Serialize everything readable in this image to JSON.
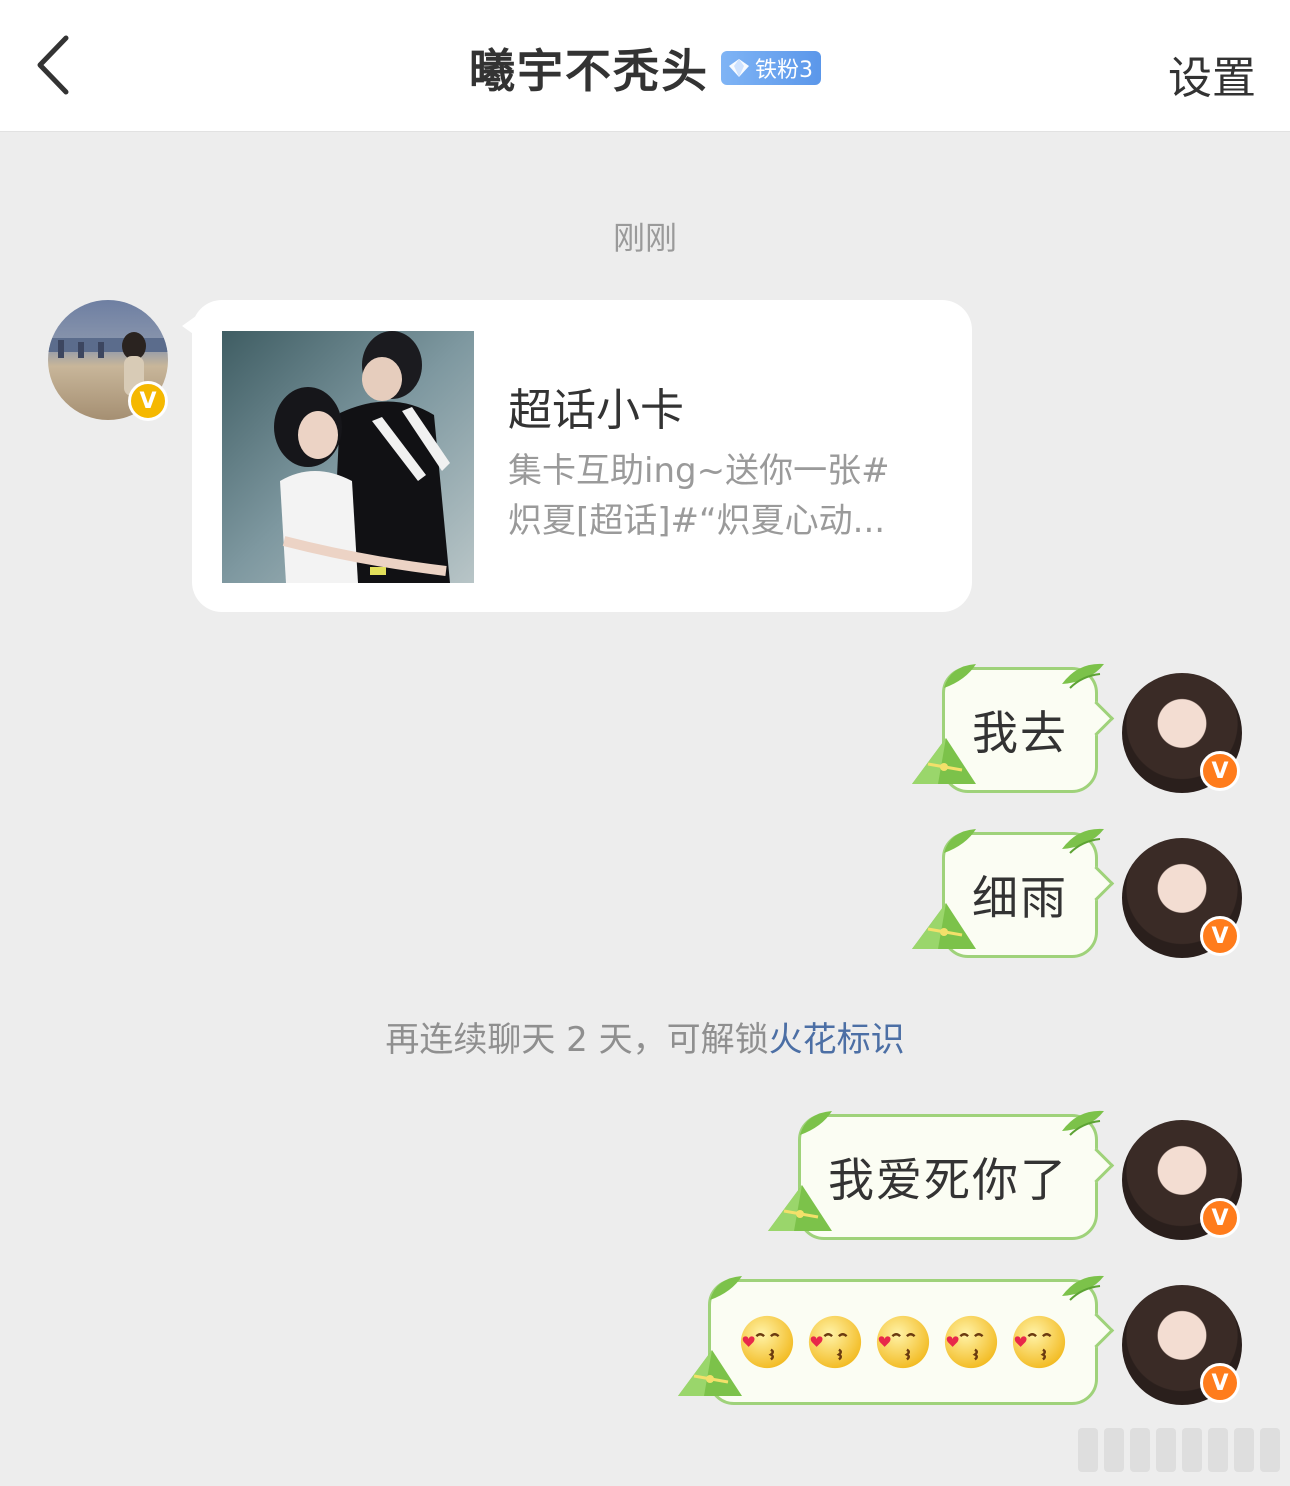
{
  "header": {
    "title": "曦宇不秃头",
    "fan_badge": "铁粉3",
    "settings_label": "设置"
  },
  "chat": {
    "timestamp": "刚刚",
    "card": {
      "title": "超话小卡",
      "desc_line1": "集卡互助ing~送你一张#",
      "desc_line2": "炽夏[超话]#“炽夏心动..."
    },
    "messages": [
      {
        "text": "我去"
      },
      {
        "text": "细雨"
      },
      {
        "text": "我爱死你了"
      },
      {
        "emoji_name": "kiss-face-emoji",
        "count": 5
      }
    ],
    "notice": {
      "text": "再连续聊天 2 天，可解锁",
      "link": "火花标识"
    }
  },
  "colors": {
    "header_bg": "#ffffff",
    "chat_bg": "#ededed",
    "bubble_border": "#9fd27a",
    "bubble_bg": "#fbfdf3",
    "fan_badge": "#6aa3ef",
    "verified_yellow": "#f5b800",
    "verified_orange": "#ff7c1c",
    "link": "#4c6fa5"
  },
  "icons": {
    "back": "chevron-left-icon",
    "badge": "diamond-icon",
    "verified": "verified-v-icon"
  }
}
